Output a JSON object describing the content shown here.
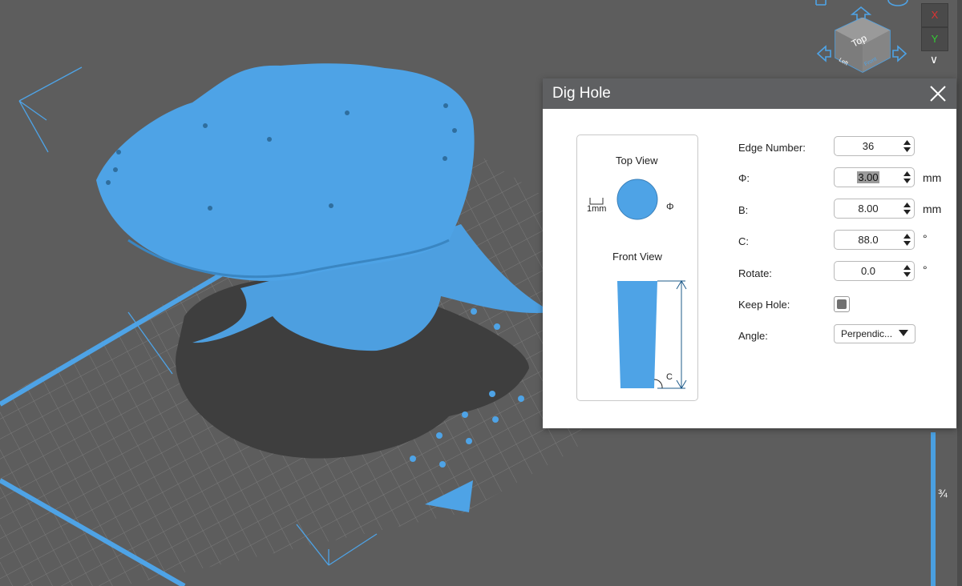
{
  "viewport": {
    "model_color": "#4ea3e6",
    "platform_line_color": "#4ea3e6",
    "view_cube": {
      "top": "Top",
      "left": "Left",
      "front": "Front"
    }
  },
  "toolbar": {
    "axis_x": "X",
    "axis_y": "Y",
    "layer_value": "¾"
  },
  "dialog": {
    "title": "Dig Hole",
    "preview": {
      "top_view_label": "Top View",
      "front_view_label": "Front View",
      "scale_label": "1mm",
      "phi_symbol": "Φ",
      "c_label": "C"
    },
    "fields": {
      "edge_number": {
        "label": "Edge Number:",
        "value": "36"
      },
      "phi": {
        "label": "Φ:",
        "value": "3.00",
        "unit": "mm"
      },
      "b": {
        "label": "B:",
        "value": "8.00",
        "unit": "mm"
      },
      "c": {
        "label": "C:",
        "value": "88.0",
        "unit": "°"
      },
      "rotate": {
        "label": "Rotate:",
        "value": "0.0",
        "unit": "°"
      },
      "keep_hole": {
        "label": "Keep Hole:",
        "checked": true
      },
      "angle": {
        "label": "Angle:",
        "value": "Perpendic..."
      }
    }
  }
}
